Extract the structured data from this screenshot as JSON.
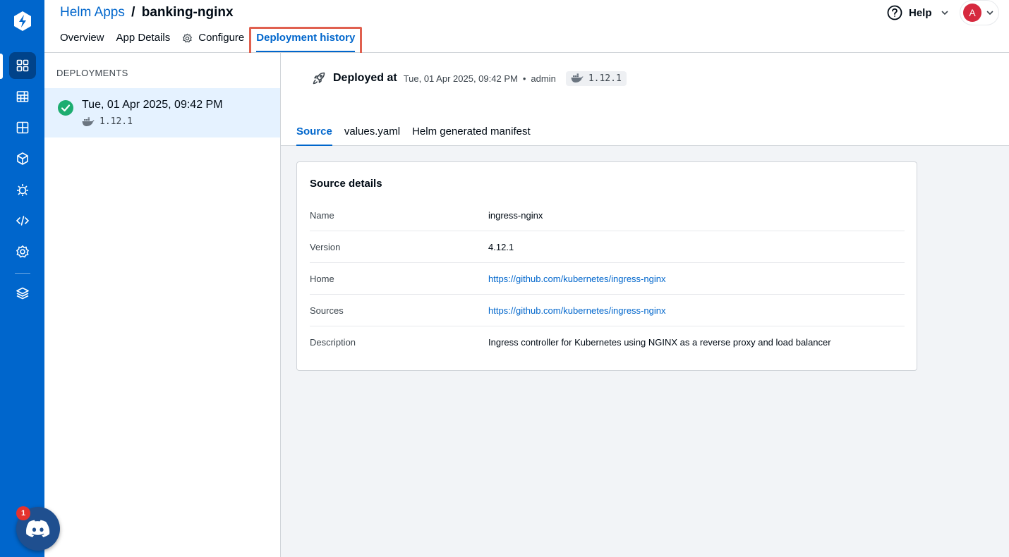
{
  "header": {
    "breadcrumb_parent": "Helm Apps",
    "breadcrumb_sep": "/",
    "breadcrumb_current": "banking-nginx",
    "tabs": [
      {
        "label": "Overview"
      },
      {
        "label": "App Details"
      },
      {
        "label": "Configure"
      },
      {
        "label": "Deployment history"
      }
    ],
    "active_tab": "Deployment history",
    "help_label": "Help",
    "avatar_initial": "A"
  },
  "deployments": {
    "title": "DEPLOYMENTS",
    "items": [
      {
        "date": "Tue, 01 Apr 2025, 09:42 PM",
        "tag": "1.12.1",
        "status": "success"
      }
    ]
  },
  "detail": {
    "deployed_label": "Deployed at",
    "deployed_time": "Tue, 01 Apr 2025, 09:42 PM",
    "dot": "•",
    "deployed_by": "admin",
    "image_tag": "1.12.1",
    "tabs": [
      {
        "label": "Source"
      },
      {
        "label": "values.yaml"
      },
      {
        "label": "Helm generated manifest"
      }
    ],
    "active_tab": "Source"
  },
  "source_details": {
    "title": "Source details",
    "rows": [
      {
        "key": "Name",
        "value": "ingress-nginx"
      },
      {
        "key": "Version",
        "value": "4.12.1"
      },
      {
        "key": "Home",
        "value": "https://github.com/kubernetes/ingress-nginx"
      },
      {
        "key": "Sources",
        "value": "https://github.com/kubernetes/ingress-nginx"
      },
      {
        "key": "Description",
        "value": "Ingress controller for Kubernetes using NGINX as a reverse proxy and load balancer"
      }
    ]
  },
  "chat": {
    "badge_count": "1"
  },
  "colors": {
    "rail": "#0066cc",
    "accent": "#0066cc",
    "highlight": "#e0604f",
    "success": "#1dad70",
    "avatar": "#d6293e",
    "selected_row": "#e5f2ff"
  }
}
